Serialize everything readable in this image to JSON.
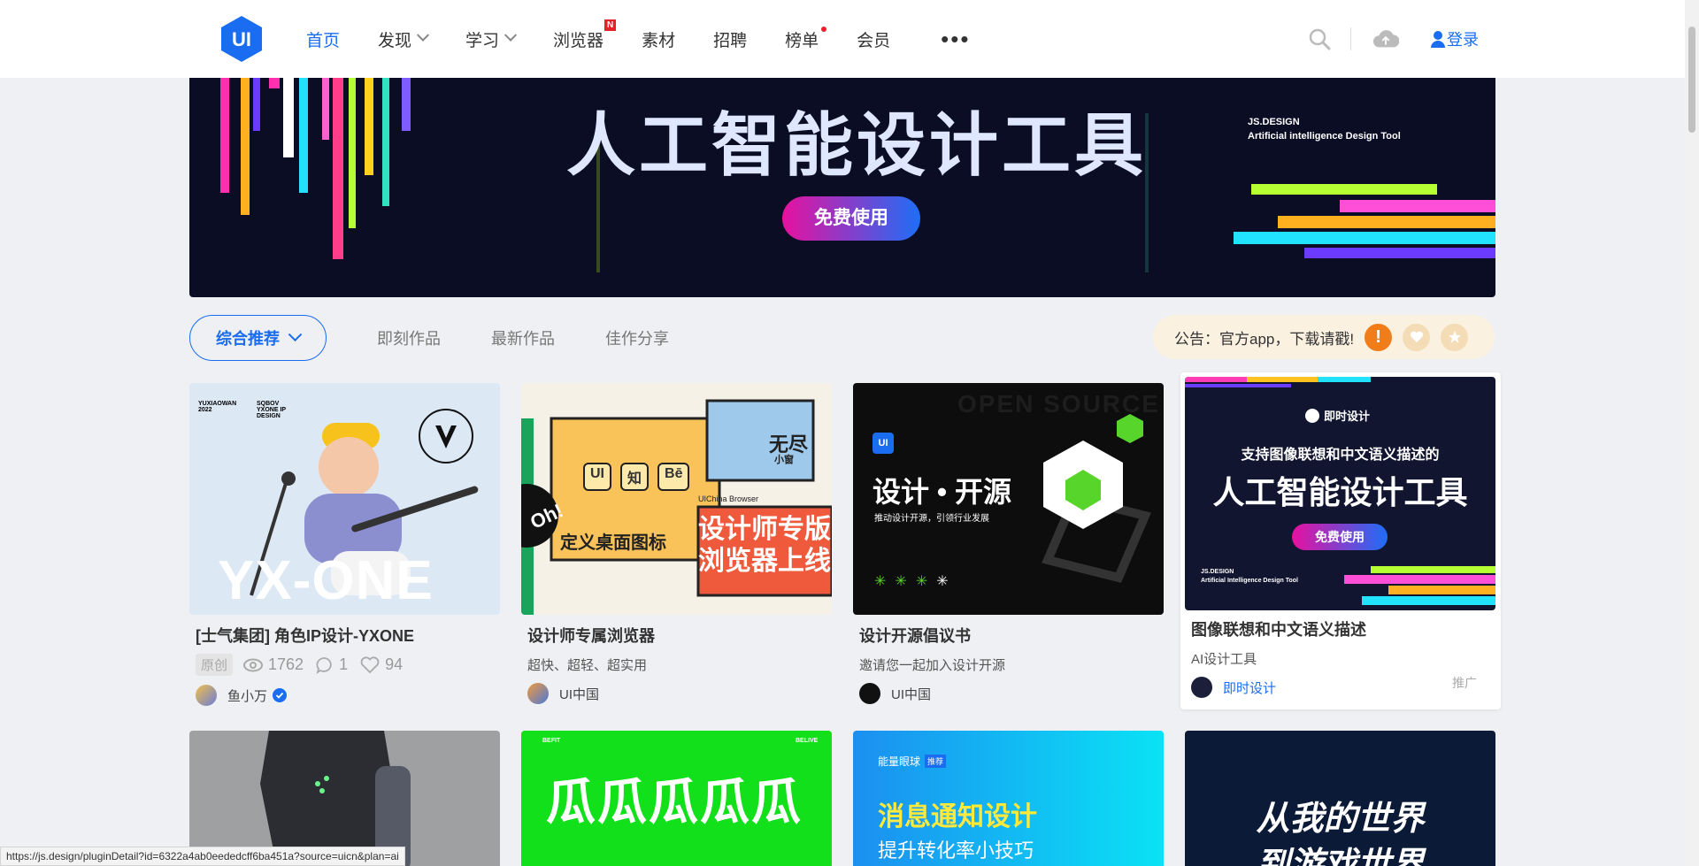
{
  "header": {
    "logo_text": "UI",
    "nav": [
      {
        "label": "首页",
        "active": true
      },
      {
        "label": "发现",
        "dropdown": true
      },
      {
        "label": "学习",
        "dropdown": true
      },
      {
        "label": "浏览器",
        "badge": "N"
      },
      {
        "label": "素材"
      },
      {
        "label": "招聘"
      },
      {
        "label": "榜单",
        "dot": true
      },
      {
        "label": "会员"
      }
    ],
    "more": "•••",
    "login": "登录"
  },
  "banner": {
    "title": "人工智能设计工具",
    "button": "免费使用",
    "brand_line1": "JS.DESIGN",
    "brand_line2": "Artificial intelligence Design Tool"
  },
  "tabs": {
    "active": "综合推荐",
    "items": [
      "即刻作品",
      "最新作品",
      "佳作分享"
    ]
  },
  "notice": {
    "text": "公告：官方app，下载请戳!",
    "icon_colors": [
      "#f07c1a",
      "#f4dcb7",
      "#f4dcb7"
    ]
  },
  "cards": [
    {
      "title": "[士气集团] 角色IP设计-YXONE",
      "tag": "原创",
      "views": "1762",
      "comments": "1",
      "likes": "94",
      "author": "鱼小万",
      "thumb_text": "YX-ONE",
      "thumb_small1": "YUXIAOWAN 2022",
      "thumb_small2": "SQBOV YXONE IP DESIGN"
    },
    {
      "title": "设计师专属浏览器",
      "subtitle": "超快、超轻、超实用",
      "author": "UI中国",
      "thumb_line1": "设计师专版",
      "thumb_line2": "浏览器上线",
      "thumb_tag": "定义桌面图标",
      "thumb_box": "无尽",
      "thumb_box_small": "小窗",
      "thumb_oh": "Oh!",
      "thumb_icons": [
        "UI",
        "知",
        "Bē"
      ],
      "thumb_caption": "UIChina Browser"
    },
    {
      "title": "设计开源倡议书",
      "subtitle": "邀请您一起加入设计开源",
      "author": "UI中国",
      "thumb_main": "设计 • 开源",
      "thumb_small": "推动设计开源，引领行业发展",
      "thumb_bg": "OPEN SOURCE",
      "thumb_logo": "UI"
    }
  ],
  "promo": {
    "title": "图像联想和中文语义描述",
    "subtitle": "AI设计工具",
    "author": "即时设计",
    "ad": "推广",
    "thumb_brand": "即时设计",
    "thumb_line1": "支持图像联想和中文语义描述的",
    "thumb_line2": "人工智能设计工具",
    "thumb_btn": "免费使用",
    "thumb_foot1": "JS.DESIGN",
    "thumb_foot2": "Artificial Intelligence Design Tool"
  },
  "row2": [
    {
      "bg": "#9fa0a2"
    },
    {
      "bg": "#11e01a",
      "text": "瓜瓜瓜瓜瓜",
      "small_left": "BEFIT",
      "small_right": "BELIVE"
    },
    {
      "bg": "#1b9fef",
      "text": "消息通知设计",
      "sub": "提升转化率小技巧",
      "tag": "能量眼球",
      "tag2": "推荐"
    },
    {
      "bg": "#0b1a37",
      "text": "从我的世界",
      "text2": "到游戏世界"
    }
  ],
  "statusbar": "https://js.design/pluginDetail?id=6322a4ab0eededcff6ba451a?source=uicn&plan=ai"
}
